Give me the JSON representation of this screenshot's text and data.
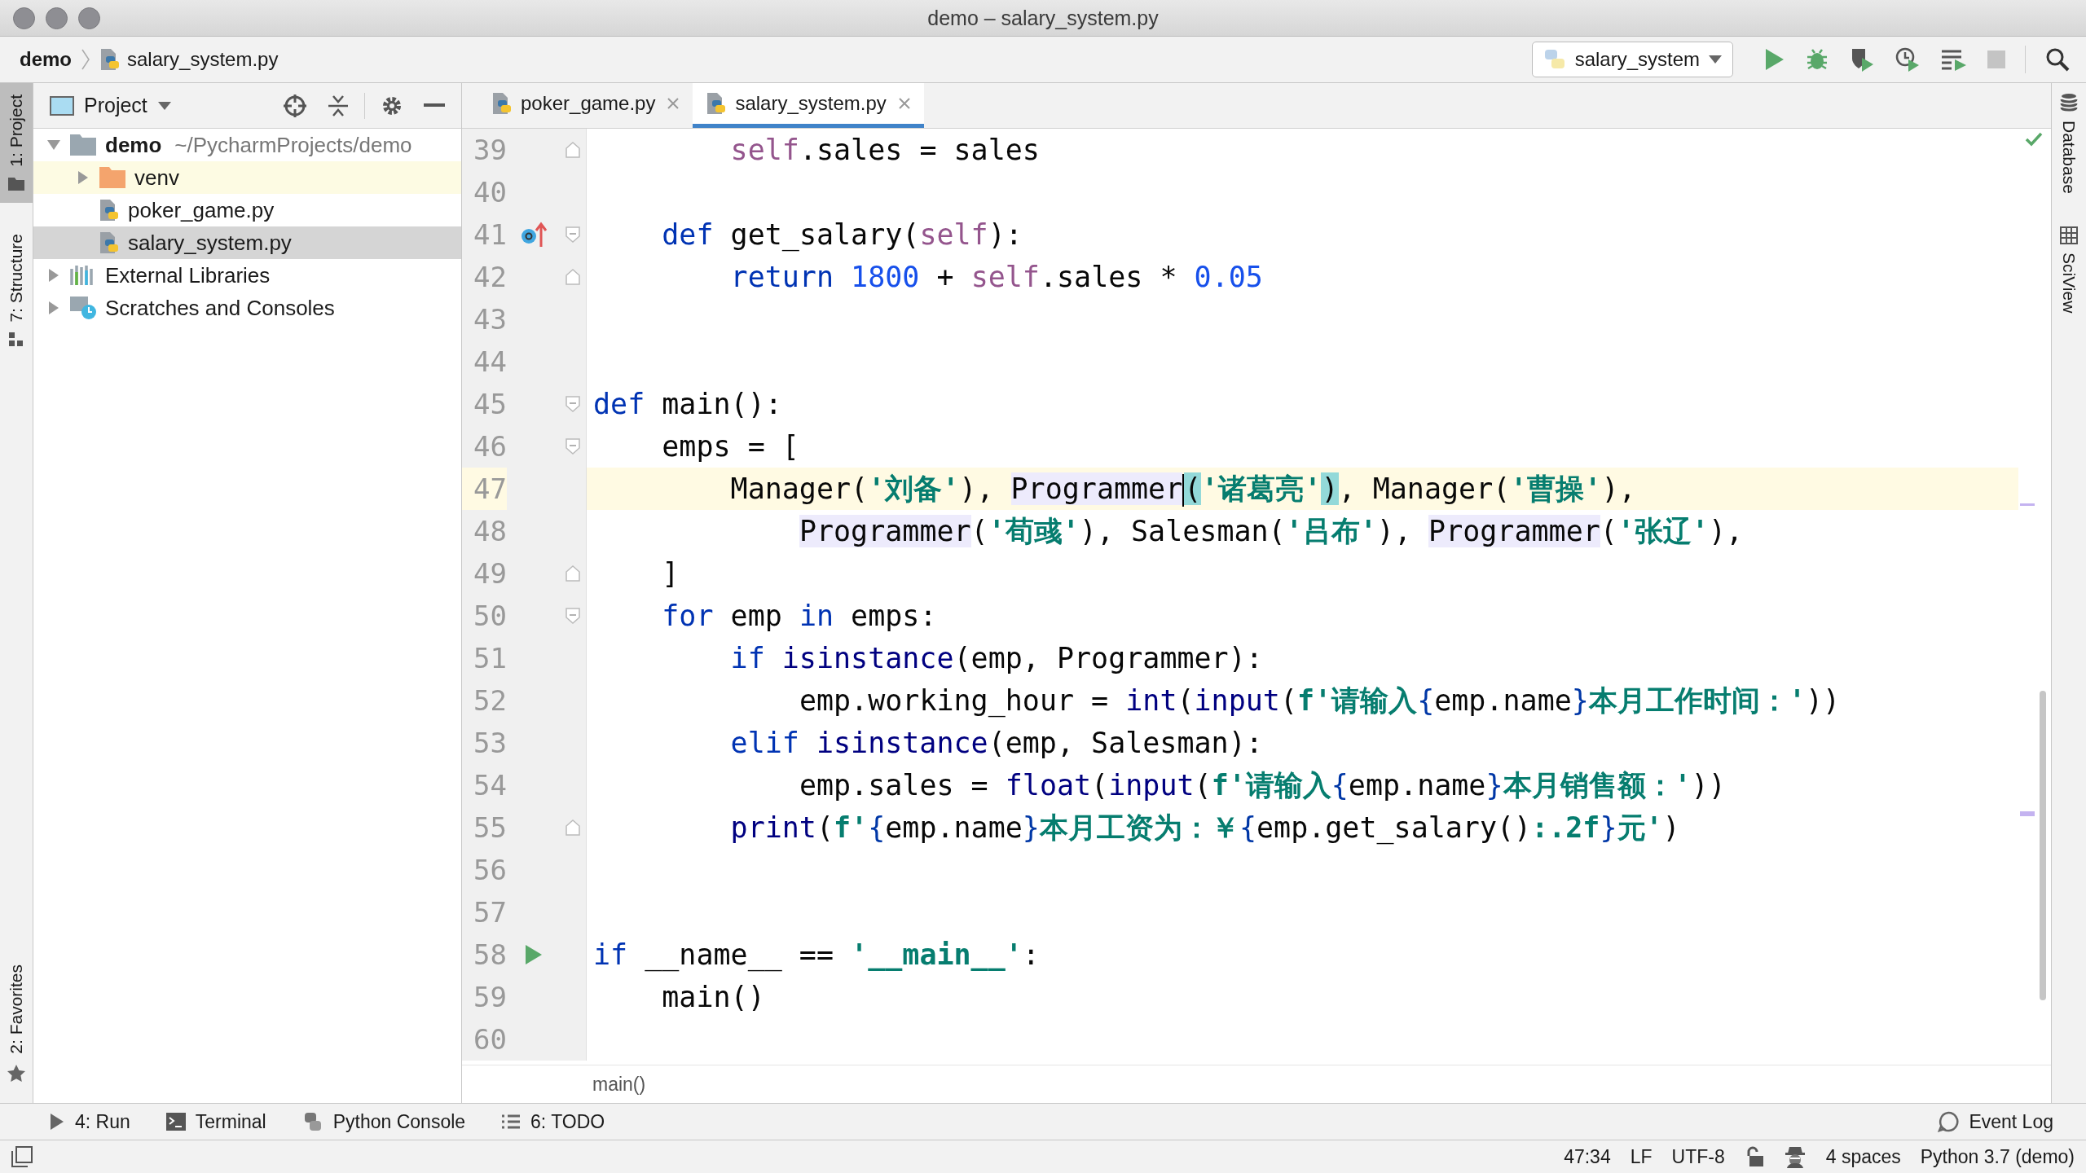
{
  "window": {
    "title": "demo – salary_system.py"
  },
  "navbar": {
    "crumbs": [
      {
        "label": "demo",
        "kind": "project"
      },
      {
        "label": "salary_system.py",
        "kind": "python"
      }
    ],
    "run_config": "salary_system"
  },
  "left_stripe": {
    "top": [
      {
        "label": "1: Project",
        "kind": "folder",
        "selected": true
      },
      {
        "label": "7: Structure",
        "kind": "structure",
        "selected": false
      }
    ],
    "bottom": [
      {
        "label": "2: Favorites",
        "kind": "star",
        "selected": false
      }
    ]
  },
  "project_panel": {
    "title": "Project",
    "tree": [
      {
        "label": "demo",
        "note": "~/PycharmProjects/demo",
        "kind": "folder",
        "expanded": true,
        "selected": false,
        "children": [
          {
            "label": "venv",
            "kind": "excluded",
            "expanded": false,
            "selected": false
          },
          {
            "label": "poker_game.py",
            "kind": "python",
            "selected": false
          },
          {
            "label": "salary_system.py",
            "kind": "python",
            "selected": true
          }
        ]
      },
      {
        "label": "External Libraries",
        "kind": "library",
        "expanded": false,
        "selected": false
      },
      {
        "label": "Scratches and Consoles",
        "kind": "scratches",
        "expanded": false,
        "selected": false
      }
    ]
  },
  "tabs": [
    {
      "label": "poker_game.py",
      "selected": false
    },
    {
      "label": "salary_system.py",
      "selected": true
    }
  ],
  "editor": {
    "lines": [
      {
        "num": "39",
        "current": false,
        "tokens": [
          {
            "text": "        self",
            "kind": "self"
          },
          {
            "text": ".sales = sales",
            "kind": "plain"
          }
        ],
        "fold_marker": {
          "kind": "end"
        }
      },
      {
        "num": "40",
        "current": false
      },
      {
        "num": "41",
        "current": false,
        "tokens": [
          {
            "text": "    def ",
            "kind": "keyword"
          },
          {
            "text": "get_salary(",
            "kind": "plain"
          },
          {
            "text": "self",
            "kind": "self"
          },
          {
            "text": "):",
            "kind": "plain"
          }
        ],
        "gutter_icon": {
          "kind": "override"
        },
        "fold_marker": {
          "kind": "start"
        }
      },
      {
        "num": "42",
        "current": false,
        "tokens": [
          {
            "text": "        return ",
            "kind": "keyword"
          },
          {
            "text": "1800",
            "kind": "number"
          },
          {
            "text": " + ",
            "kind": "plain"
          },
          {
            "text": "self",
            "kind": "self"
          },
          {
            "text": ".sales * ",
            "kind": "plain"
          },
          {
            "text": "0.05",
            "kind": "number"
          }
        ],
        "fold_marker": {
          "kind": "end"
        }
      },
      {
        "num": "43",
        "current": false
      },
      {
        "num": "44",
        "current": false
      },
      {
        "num": "45",
        "current": false,
        "tokens": [
          {
            "text": "def ",
            "kind": "keyword"
          },
          {
            "text": "main():",
            "kind": "plain"
          }
        ],
        "fold_marker": {
          "kind": "start"
        }
      },
      {
        "num": "46",
        "current": false,
        "tokens": [
          {
            "text": "    emps = [",
            "kind": "plain"
          }
        ],
        "fold_marker": {
          "kind": "start"
        }
      },
      {
        "num": "47",
        "current": true,
        "tokens": [
          {
            "text": "        Manager(",
            "kind": "plain"
          },
          {
            "text": "'刘备'",
            "kind": "string"
          },
          {
            "text": "), ",
            "kind": "plain"
          },
          {
            "text": "Programmer",
            "kind": "plain",
            "usage_highlight": true,
            "caret": true
          },
          {
            "text": "(",
            "kind": "plain",
            "bracket_match": true
          },
          {
            "text": "'诸葛亮'",
            "kind": "string"
          },
          {
            "text": ")",
            "kind": "plain",
            "bracket_match": true
          },
          {
            "text": ", Manager(",
            "kind": "plain"
          },
          {
            "text": "'曹操'",
            "kind": "string"
          },
          {
            "text": "),",
            "kind": "plain"
          }
        ]
      },
      {
        "num": "48",
        "current": false,
        "tokens": [
          {
            "text": "            Programmer",
            "kind": "plain",
            "usage_highlight": true
          },
          {
            "text": "(",
            "kind": "plain"
          },
          {
            "text": "'荀彧'",
            "kind": "string"
          },
          {
            "text": "), Salesman(",
            "kind": "plain"
          },
          {
            "text": "'吕布'",
            "kind": "string"
          },
          {
            "text": "), ",
            "kind": "plain"
          },
          {
            "text": "Programmer",
            "kind": "plain",
            "usage_highlight": true
          },
          {
            "text": "(",
            "kind": "plain"
          },
          {
            "text": "'张辽'",
            "kind": "string"
          },
          {
            "text": "),",
            "kind": "plain"
          }
        ]
      },
      {
        "num": "49",
        "current": false,
        "tokens": [
          {
            "text": "    ]",
            "kind": "plain"
          }
        ],
        "fold_marker": {
          "kind": "end"
        }
      },
      {
        "num": "50",
        "current": false,
        "tokens": [
          {
            "text": "    for ",
            "kind": "keyword"
          },
          {
            "text": "emp ",
            "kind": "plain"
          },
          {
            "text": "in ",
            "kind": "keyword"
          },
          {
            "text": "emps:",
            "kind": "plain"
          }
        ],
        "fold_marker": {
          "kind": "start"
        }
      },
      {
        "num": "51",
        "current": false,
        "tokens": [
          {
            "text": "        if ",
            "kind": "keyword"
          },
          {
            "text": "isinstance",
            "kind": "builtin"
          },
          {
            "text": "(emp, Programmer):",
            "kind": "plain"
          }
        ]
      },
      {
        "num": "52",
        "current": false,
        "tokens": [
          {
            "text": "            emp.working_hour = ",
            "kind": "plain"
          },
          {
            "text": "int",
            "kind": "builtin"
          },
          {
            "text": "(",
            "kind": "plain"
          },
          {
            "text": "input",
            "kind": "builtin"
          },
          {
            "text": "(",
            "kind": "plain"
          },
          {
            "text": "f'请输入",
            "kind": "string"
          },
          {
            "text": "{",
            "kind": "brace"
          },
          {
            "text": "emp.name",
            "kind": "plain"
          },
          {
            "text": "}",
            "kind": "brace"
          },
          {
            "text": "本月工作时间：'",
            "kind": "string"
          },
          {
            "text": "))",
            "kind": "plain"
          }
        ]
      },
      {
        "num": "53",
        "current": false,
        "tokens": [
          {
            "text": "        elif ",
            "kind": "keyword"
          },
          {
            "text": "isinstance",
            "kind": "builtin"
          },
          {
            "text": "(emp, Salesman):",
            "kind": "plain"
          }
        ]
      },
      {
        "num": "54",
        "current": false,
        "tokens": [
          {
            "text": "            emp.sales = ",
            "kind": "plain"
          },
          {
            "text": "float",
            "kind": "builtin"
          },
          {
            "text": "(",
            "kind": "plain"
          },
          {
            "text": "input",
            "kind": "builtin"
          },
          {
            "text": "(",
            "kind": "plain"
          },
          {
            "text": "f'请输入",
            "kind": "string"
          },
          {
            "text": "{",
            "kind": "brace"
          },
          {
            "text": "emp.name",
            "kind": "plain"
          },
          {
            "text": "}",
            "kind": "brace"
          },
          {
            "text": "本月销售额：'",
            "kind": "string"
          },
          {
            "text": "))",
            "kind": "plain"
          }
        ]
      },
      {
        "num": "55",
        "current": false,
        "tokens": [
          {
            "text": "        print",
            "kind": "builtin"
          },
          {
            "text": "(",
            "kind": "plain"
          },
          {
            "text": "f'",
            "kind": "string"
          },
          {
            "text": "{",
            "kind": "brace"
          },
          {
            "text": "emp.name",
            "kind": "plain"
          },
          {
            "text": "}",
            "kind": "brace"
          },
          {
            "text": "本月工资为：￥",
            "kind": "string"
          },
          {
            "text": "{",
            "kind": "brace"
          },
          {
            "text": "emp.get_salary()",
            "kind": "plain"
          },
          {
            "text": ":.2f",
            "kind": "string"
          },
          {
            "text": "}",
            "kind": "brace"
          },
          {
            "text": "元'",
            "kind": "string"
          },
          {
            "text": ")",
            "kind": "plain"
          }
        ],
        "fold_marker": {
          "kind": "end"
        }
      },
      {
        "num": "56",
        "current": false
      },
      {
        "num": "57",
        "current": false
      },
      {
        "num": "58",
        "current": false,
        "tokens": [
          {
            "text": "if ",
            "kind": "keyword"
          },
          {
            "text": "__name__ == ",
            "kind": "plain"
          },
          {
            "text": "'__main__'",
            "kind": "string"
          },
          {
            "text": ":",
            "kind": "plain"
          }
        ],
        "gutter_icon": {
          "kind": "run"
        }
      },
      {
        "num": "59",
        "current": false,
        "tokens": [
          {
            "text": "    main()",
            "kind": "plain"
          }
        ]
      },
      {
        "num": "60",
        "current": false
      }
    ],
    "breadcrumb": "main()"
  },
  "right_stripe": [
    {
      "label": "Database",
      "kind": "database"
    },
    {
      "label": "SciView",
      "kind": "sciview"
    }
  ],
  "tool_windows": [
    {
      "label": "4: Run",
      "kind": "run"
    },
    {
      "label": "Terminal",
      "kind": "terminal"
    },
    {
      "label": "Python Console",
      "kind": "console"
    },
    {
      "label": "6: TODO",
      "kind": "todo"
    }
  ],
  "event_log": "Event Log",
  "status_bar": [
    {
      "label": "47:34",
      "kind": "text"
    },
    {
      "label": "LF",
      "kind": "text"
    },
    {
      "label": "UTF-8",
      "kind": "text"
    },
    {
      "kind": "lock"
    },
    {
      "kind": "inspector"
    },
    {
      "label": "4 spaces",
      "kind": "text"
    },
    {
      "label": "Python 3.7 (demo)",
      "kind": "text"
    }
  ]
}
